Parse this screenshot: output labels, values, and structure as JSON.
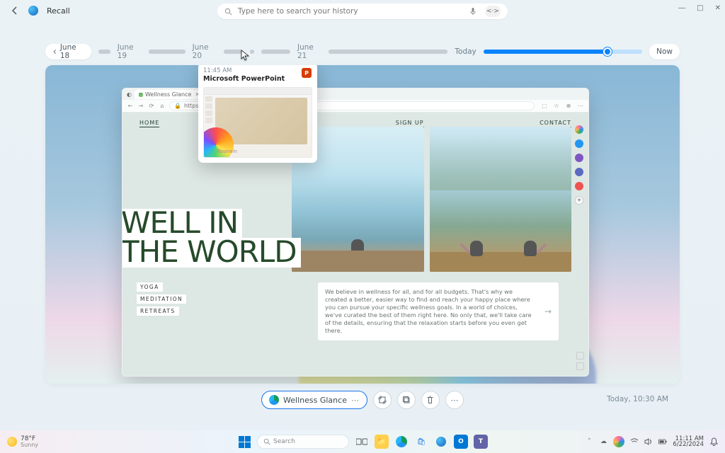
{
  "header": {
    "app_title": "Recall",
    "search_placeholder": "Type here to search your history"
  },
  "timeline": {
    "dates": [
      "June 18",
      "June 19",
      "June 20",
      "June 21"
    ],
    "today_label": "Today",
    "now_label": "Now"
  },
  "preview": {
    "time": "11:45 AM",
    "app_name": "Microsoft PowerPoint",
    "app_short": "P",
    "slide_label": "Rosewin"
  },
  "snapshot": {
    "tab_title": "Wellness Glance",
    "url": "https://wellnessglance.com",
    "nav_left": "HOME",
    "nav_mid": "SIGN UP",
    "nav_right": "CONTACT",
    "hero_line1": "WELL IN",
    "hero_line2": "THE WORLD",
    "tags": [
      "YOGA",
      "MEDITATION",
      "RETREATS"
    ],
    "description": "We believe in wellness for all, and for all budgets. That's why we created a better, easier way to find and reach your happy place where you can pursue your specific wellness goals. In a world of choices, we've curated the best of them right here. No only that, we'll take care of the details, ensuring that the relaxation starts before you even get there."
  },
  "actions": {
    "app_label": "Wellness Glance"
  },
  "timestamp": "Today, 10:30 AM",
  "taskbar": {
    "temp": "78°F",
    "condition": "Sunny",
    "search": "Search",
    "time": "11:11 AM",
    "date": "6/22/2024"
  }
}
